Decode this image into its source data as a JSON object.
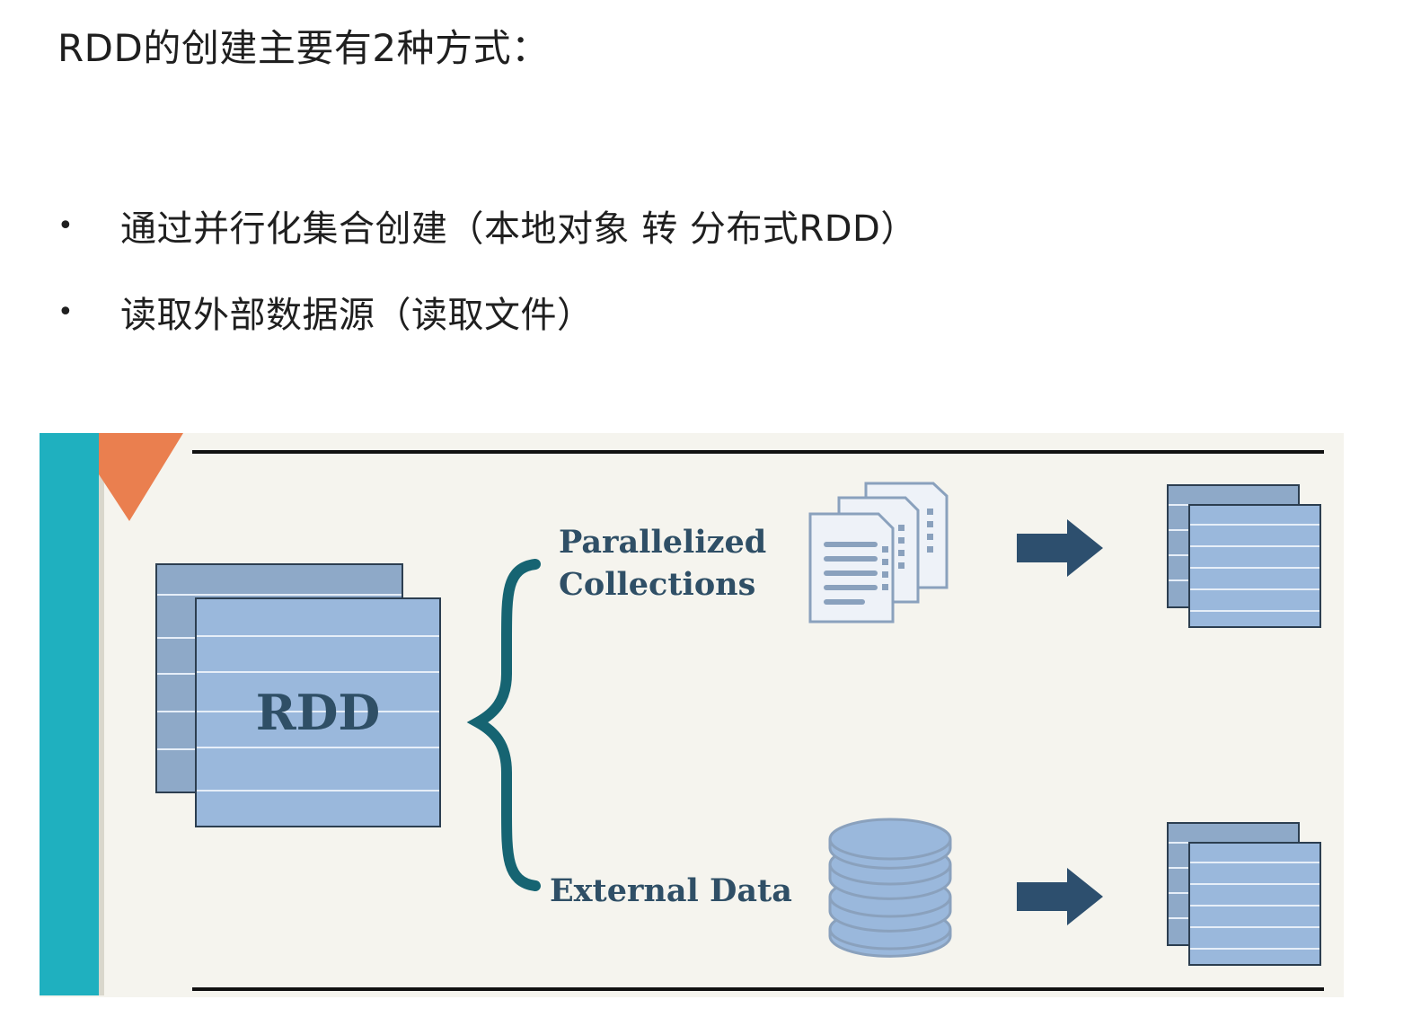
{
  "heading": "RDD的创建主要有2种方式：",
  "bullets": [
    "通过并行化集合创建（本地对象 转 分布式RDD）",
    "读取外部数据源（读取文件）"
  ],
  "diagram": {
    "rdd_label": "RDD",
    "branch_top_label_line1": "Parallelized",
    "branch_top_label_line2": "Collections",
    "branch_bottom_label": "External Data",
    "colors": {
      "teal_bar": "#1fb0bf",
      "orange_triangle": "#ea7f4f",
      "panel_bg": "#f5f4ee",
      "block_fill": "#9ab8dc",
      "block_line": "#dfeaf6",
      "arrow": "#2d4f6e",
      "brace": "#166472"
    }
  }
}
